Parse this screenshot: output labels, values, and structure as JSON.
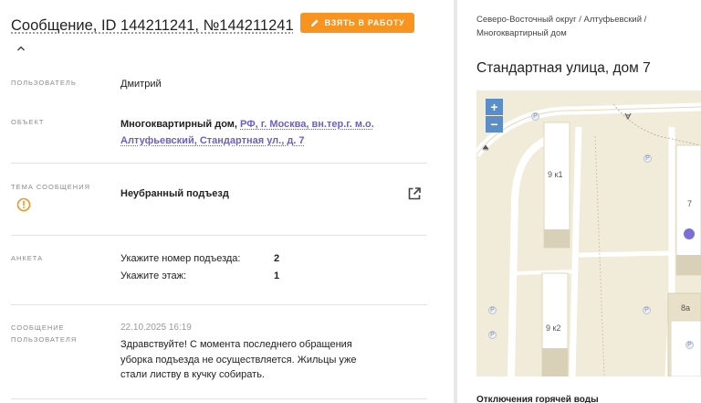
{
  "header": {
    "title": "Сообщение, ID 144211241, №144211241",
    "take_button": "ВЗЯТЬ В РАБОТУ"
  },
  "fields": {
    "user_label": "ПОЛЬЗОВАТЕЛЬ",
    "user_value": "Дмитрий",
    "object_label": "ОБЪЕКТ",
    "object_type": "Многоквартирный дом, ",
    "object_address": "РФ, г. Москва, вн.тер.г. м.о. Алтуфьевский, Стандартная ул., д. 7",
    "topic_label": "ТЕМА СООБЩЕНИЯ",
    "topic_value": "Неубранный подъезд",
    "form_label": "АНКЕТА",
    "form_items": [
      {
        "q": "Укажите номер подъезда:",
        "a": "2"
      },
      {
        "q": "Укажите этаж:",
        "a": "1"
      }
    ],
    "message_label_1": "СООБЩЕНИЕ",
    "message_label_2": "ПОЛЬЗОВАТЕЛЯ",
    "message_date": "22.10.2025 16:19",
    "message_text": "Здравствуйте! С момента последнего обращения уборка подъезда не осуществляется. Жильцы уже стали листву в кучку собирать."
  },
  "right": {
    "breadcrumb": "Северо-Восточный округ / Алтуфьевский / Многоквартирный дом",
    "address_title": "Стандартная улица, дом 7",
    "zoom_in": "+",
    "zoom_out": "−",
    "buildings": [
      "9 к1",
      "9 к2",
      "7",
      "8а"
    ],
    "parking_symbol": "P",
    "bottom_title": "Отключения горячей воды"
  },
  "colors": {
    "accent_button": "#f7931e",
    "link": "#6c5fc7",
    "warning": "#f7931e",
    "map_marker": "#7b6fd6",
    "zoom_control": "#5b8dc9"
  },
  "icons": {
    "title_toggle": "chevron-up-icon",
    "take_button": "pencil-icon",
    "topic_warning": "warning-circle-icon",
    "topic_open": "external-link-icon"
  }
}
